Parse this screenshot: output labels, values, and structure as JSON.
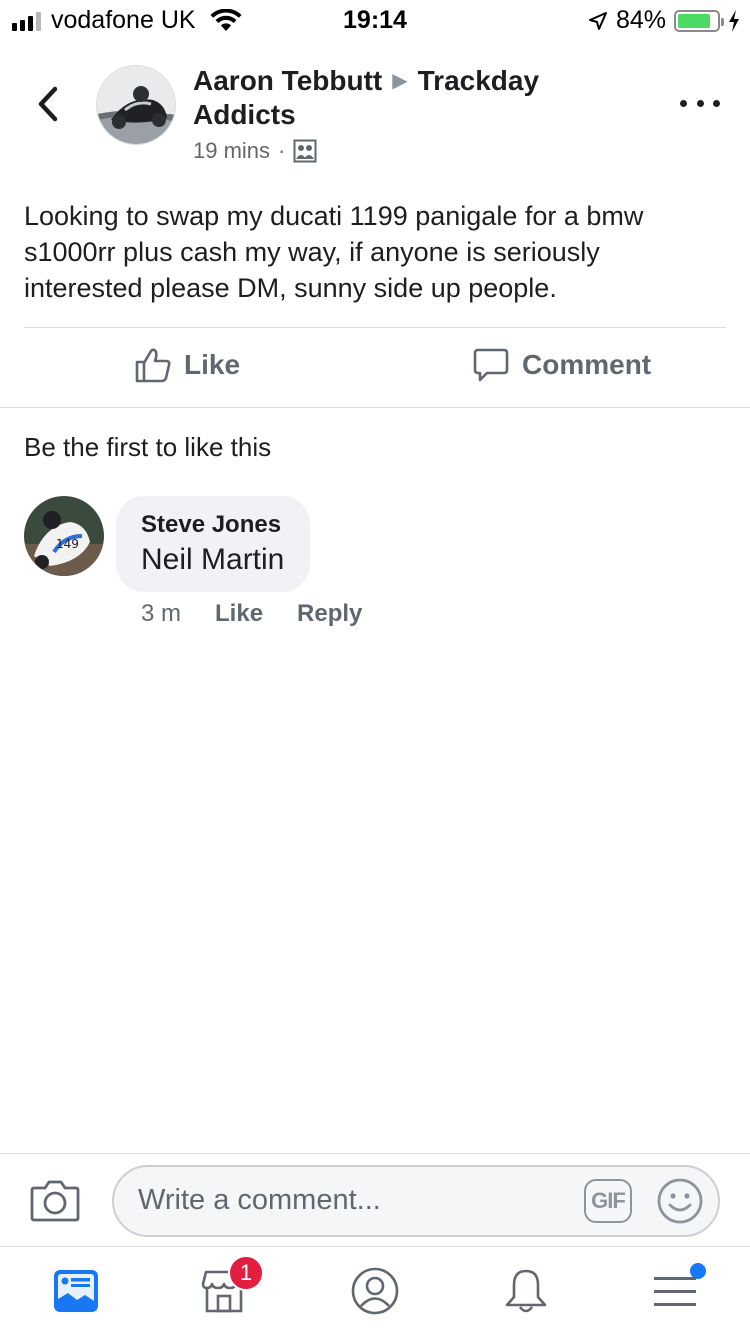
{
  "status_bar": {
    "carrier": "vodafone UK",
    "time": "19:14",
    "battery_percent": "84%",
    "battery_level": 0.84
  },
  "post": {
    "author": "Aaron Tebbutt",
    "group": "Trackday Addicts",
    "timestamp": "19 mins",
    "privacy_icon": "group-members-icon",
    "body": "Looking to swap my ducati 1199 panigale for a bmw s1000rr plus cash my way, if anyone is seriously interested please DM, sunny side up people."
  },
  "actions": {
    "like_label": "Like",
    "comment_label": "Comment"
  },
  "reactions_summary": "Be the first to like this",
  "comments": [
    {
      "author": "Steve Jones",
      "text": "Neil Martin",
      "time": "3 m",
      "like_label": "Like",
      "reply_label": "Reply"
    }
  ],
  "composer": {
    "placeholder": "Write a comment...",
    "gif_label": "GIF"
  },
  "tab_bar": {
    "items": [
      "news-feed-icon",
      "marketplace-icon",
      "profile-icon",
      "notifications-icon",
      "menu-icon"
    ],
    "marketplace_badge": "1"
  },
  "colors": {
    "accent": "#1877f2",
    "badge": "#e41e3f",
    "battery": "#4cd964"
  }
}
